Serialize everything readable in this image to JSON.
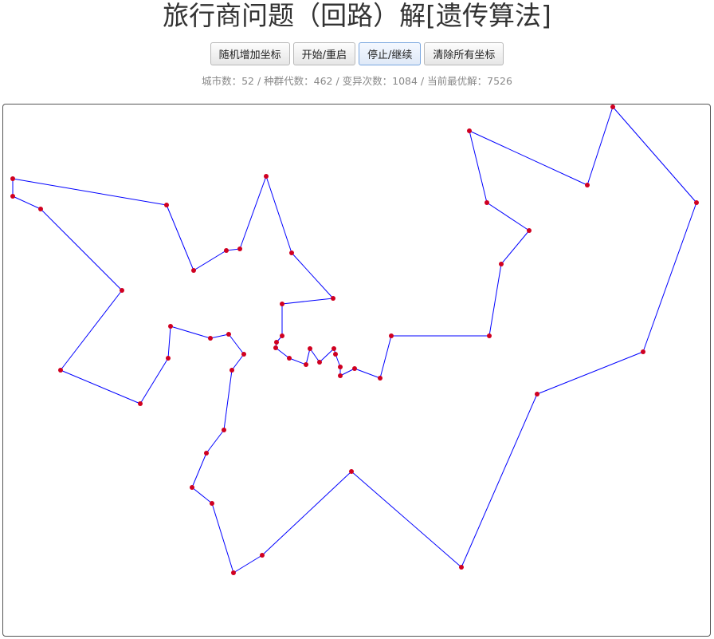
{
  "page": {
    "title": "旅行商问题（回路）解[遗传算法]"
  },
  "toolbar": {
    "buttons": [
      {
        "label": "随机增加坐标"
      },
      {
        "label": "开始/重启"
      },
      {
        "label": "停止/继续"
      },
      {
        "label": "清除所有坐标"
      }
    ],
    "active_button": "停止/继续"
  },
  "stats": {
    "text": "城市数：52 / 种群代数：462 / 变异次数：1084 / 当前最优解：7526"
  },
  "chart_data": {
    "type": "scatter",
    "description_free": "",
    "route_color": "#0000ff",
    "city_color": "#d00020",
    "closed_loop": true,
    "x_range": [
      0,
      889
    ],
    "y_range": [
      0,
      668
    ],
    "cities": [
      [
        765,
        3
      ],
      [
        870,
        123
      ],
      [
        803,
        310
      ],
      [
        670,
        363
      ],
      [
        575,
        580
      ],
      [
        437,
        460
      ],
      [
        325,
        565
      ],
      [
        289,
        587
      ],
      [
        262,
        500
      ],
      [
        237,
        480
      ],
      [
        255,
        437
      ],
      [
        277,
        408
      ],
      [
        287,
        333
      ],
      [
        302,
        313
      ],
      [
        283,
        288
      ],
      [
        260,
        293
      ],
      [
        210,
        278
      ],
      [
        207,
        318
      ],
      [
        172,
        375
      ],
      [
        72,
        333
      ],
      [
        149,
        233
      ],
      [
        47,
        131
      ],
      [
        12,
        115
      ],
      [
        12,
        93
      ],
      [
        205,
        126
      ],
      [
        239,
        208
      ],
      [
        280,
        183
      ],
      [
        297,
        181
      ],
      [
        330,
        90
      ],
      [
        362,
        186
      ],
      [
        414,
        243
      ],
      [
        350,
        250
      ],
      [
        350,
        290
      ],
      [
        343,
        298
      ],
      [
        342,
        305
      ],
      [
        359,
        318
      ],
      [
        380,
        326
      ],
      [
        385,
        306
      ],
      [
        397,
        323
      ],
      [
        415,
        306
      ],
      [
        417,
        313
      ],
      [
        423,
        329
      ],
      [
        423,
        340
      ],
      [
        441,
        331
      ],
      [
        473,
        343
      ],
      [
        487,
        290
      ],
      [
        610,
        290
      ],
      [
        625,
        200
      ],
      [
        660,
        158
      ],
      [
        607,
        123
      ],
      [
        585,
        33
      ],
      [
        733,
        101
      ]
    ]
  }
}
